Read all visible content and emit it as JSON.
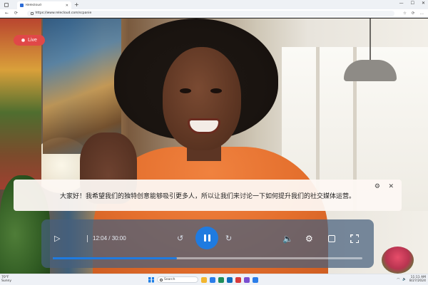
{
  "browser": {
    "tab_title": "Relecloud",
    "tab_close": "✕",
    "new_tab": "+",
    "url": "https://www.relecloud.com/scpanie",
    "window_controls": [
      "—",
      "☐",
      "✕"
    ],
    "toolbar_glyphs": [
      "☆",
      "⟳",
      "…"
    ]
  },
  "video": {
    "live_label": "Live",
    "caption_text": "大家好！我希望我们的独特创意能够吸引更多人，所以让我们来讨论一下如何提升我们的社交媒体运营。",
    "caption_settings": "⚙",
    "caption_close": "✕"
  },
  "player": {
    "play_glyph": "▷",
    "timecode": "12:04 / 30:00",
    "progress": 0.4,
    "rewind_glyph": "↺",
    "forward_glyph": "↻",
    "volume_glyph": "🔈",
    "settings_glyph": "⚙",
    "accent_color": "#1f7be0"
  },
  "taskbar": {
    "weather_line1": "70°F",
    "weather_line2": "Sunny",
    "search_label": "Search",
    "app_colors": [
      "#f2b630",
      "#2b7de9",
      "#1e8e5a",
      "#0f6cbd",
      "#d83b3b",
      "#7a4fd1",
      "#2b7de9"
    ],
    "time": "11:11 AM",
    "date": "8/27/2024"
  }
}
